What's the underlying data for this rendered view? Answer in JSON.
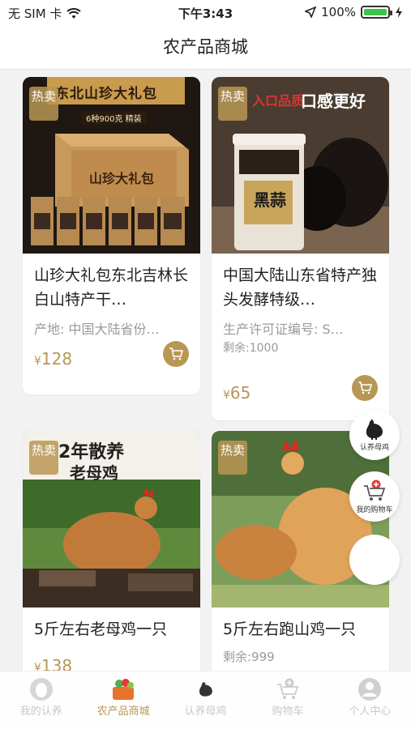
{
  "status_bar": {
    "carrier": "无 SIM 卡",
    "time": "下午3:43",
    "battery": "100%"
  },
  "nav": {
    "title": "农产品商城"
  },
  "products": [
    {
      "badge": "热卖",
      "image_text": "东北山珍大礼包",
      "image_sub": "6种900克 精装",
      "box_text": "山珍大礼包",
      "title": "山珍大礼包东北吉林长白山特产干…",
      "subtitle": "产地: 中国大陆省份…",
      "stock": "",
      "price": "128",
      "currency": "¥"
    },
    {
      "badge": "热卖",
      "image_text": "入口品质",
      "image_text2": "口感更好",
      "jar_text": "黑蒜",
      "title": "中国大陆山东省特产独头发酵特级…",
      "subtitle": "生产许可证编号: S…",
      "stock": "剩余:1000",
      "price": "65",
      "currency": "¥"
    },
    {
      "badge": "热卖",
      "image_text": "2年散养",
      "image_text2": "老母鸡",
      "title": "5斤左右老母鸡一只",
      "subtitle": "",
      "stock": "",
      "price": "138",
      "currency": "¥"
    },
    {
      "badge": "热卖",
      "title": "5斤左右跑山鸡一只",
      "subtitle": "",
      "stock": "剩余:999",
      "price": "",
      "currency": ""
    }
  ],
  "floating": {
    "adopt_label": "认养母鸡",
    "cart_label": "我的购物车"
  },
  "tabbar": [
    {
      "label": "我的认养",
      "icon": "egg-icon",
      "active": false
    },
    {
      "label": "农产品商城",
      "icon": "basket-icon",
      "active": true
    },
    {
      "label": "认养母鸡",
      "icon": "chicken-icon",
      "active": false
    },
    {
      "label": "购物车",
      "icon": "cart-icon",
      "active": false
    },
    {
      "label": "个人中心",
      "icon": "user-icon",
      "active": false
    }
  ],
  "colors": {
    "accent": "#b89754",
    "background": "#f2f2f2"
  }
}
